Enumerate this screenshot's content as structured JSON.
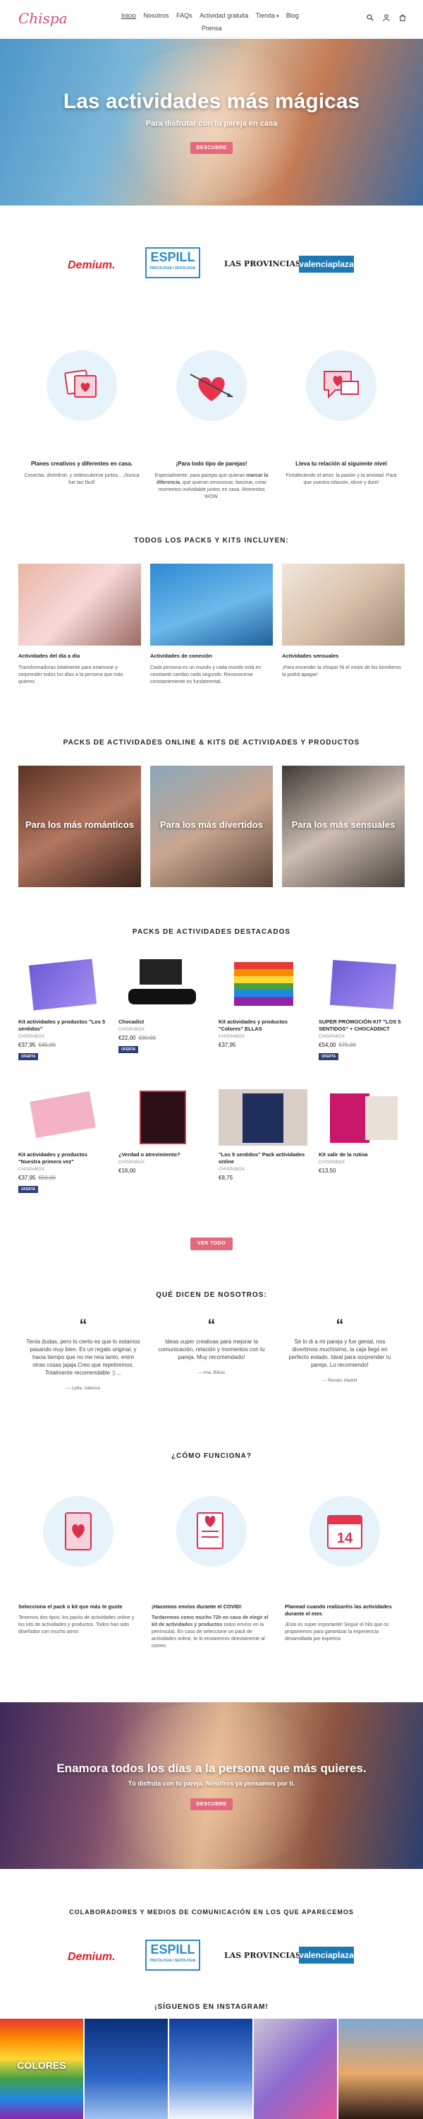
{
  "brand": {
    "logo_text": "Chispa",
    "accent": "#e26a7b",
    "navy": "#2b3f78"
  },
  "nav": {
    "items": [
      "Inicio",
      "Nosotros",
      "FAQs",
      "Actividad gratuita",
      "Tienda",
      "Blog"
    ],
    "second_line": "Prensa",
    "active": "Inicio"
  },
  "header_icons": [
    "search-icon",
    "user-icon",
    "cart-icon"
  ],
  "hero": {
    "title": "Las actividades más mágicas",
    "subtitle": "Para disfrutar con tu pareja en casa",
    "button": "DESCUBRE"
  },
  "press_logos": {
    "demium": "Demium.",
    "espill": "ESPILL",
    "espill_small": "PSICOLOGIA I SEXOLOGIA",
    "provincias": "LAS PROVINCIAS",
    "valencia": "valenciaplaza"
  },
  "features": [
    {
      "title": "Planes creativos y diferentes en casa.",
      "text": "Conectar, divertirse, y redescubrirse juntos... ¡Nunca fue tan fácil!"
    },
    {
      "title": "¡Para todo tipo de parejas!",
      "text_before": "Especialmente, para parejas que quieran ",
      "text_bold": "marcar la diferencia",
      "text_after": ", que quieran emocionar, fascinar, crear momentos inolvidable juntos en casa. Momentos WOW."
    },
    {
      "title": "Lleva tu relación al siguiente nivel",
      "text": "Fortaleciendo el amor, la pasión y la amistad. Para que vuestra relación, iduve y dure!"
    }
  ],
  "includes": {
    "title": "TODOS LOS PACKS Y KITS INCLUYEN:",
    "items": [
      {
        "title": "Actividades del día a día",
        "text": "Transformadoras totalmente para enamorar y sorprender todos los días a la persona que más quieres."
      },
      {
        "title": "Actividades de conexión",
        "text": "Cada persona es un mundo y cada mundo está en constante cambio cada segundo. Reconocerse constantemente es fundamental."
      },
      {
        "title": "Actividades sensuales",
        "text": "¡Para encender la chispa! Ni el mejor de los bomberos la podrá apagar!"
      }
    ]
  },
  "packs_online": {
    "title": "PACKS DE ACTIVIDADES ONLINE & KITS DE ACTIVIDADES Y PRODUCTOS",
    "items": [
      "Para los más románticos",
      "Para los más divertidos",
      "Para los más sensuales"
    ]
  },
  "featured": {
    "title": "PACKS DE ACTIVIDADES DESTACADOS",
    "products": [
      {
        "name": "Kit actividades y productos \"Los 5 sentidos\"",
        "vendor": "CHISPABOX",
        "price": "€37,95",
        "old_price": "€45,00",
        "sale": "OFERTA"
      },
      {
        "name": "Chocadict",
        "vendor": "CHISPABOX",
        "price": "€22,00",
        "old_price": "€30,00",
        "sale": "OFERTA"
      },
      {
        "name": "Kit actividades y productos \"Colores\" ELLAS",
        "vendor": "CHISPABOX",
        "price": "€37,95",
        "old_price": "",
        "sale": ""
      },
      {
        "name": "SUPER PROMOCIÓN KIT \"LOS 5 SENTIDOS\" + CHOCADDICT",
        "vendor": "CHISPABOX",
        "price": "€54,00",
        "old_price": "€75,00",
        "sale": "OFERTA"
      },
      {
        "name": "Kit actividades y productos \"Nuestra primera vez\"",
        "vendor": "CHISPABOX",
        "price": "€37,95",
        "old_price": "€50,00",
        "sale": "OFERTA"
      },
      {
        "name": "¿Verdad o atrevimiento?",
        "vendor": "CHISPABOX",
        "price": "€16,00",
        "old_price": "",
        "sale": ""
      },
      {
        "name": "\"Los 5 sentidos\" Pack actividades online",
        "vendor": "CHISPABOX",
        "price": "€8,75",
        "old_price": "",
        "sale": ""
      },
      {
        "name": "Kit salir de la rutina",
        "vendor": "CHISPABOX",
        "price": "€13,50",
        "old_price": "",
        "sale": ""
      }
    ],
    "button": "VER TODO"
  },
  "testimonials": {
    "title": "QUÉ DICEN DE NOSOTROS:",
    "items": [
      {
        "quote": "Tenía dudas, pero lo cierto es que lo estamos pasando muy bien. Es un regalo original, y hacia tiempo que no me reía tanto, entre otras cosas jajaja Creo que repetiremos. Totalmente recomendable :) ...",
        "author": "— Lydia, Valencia"
      },
      {
        "quote": "Ideas super creativas para mejorar la comunicación, relación y momentos con tu pareja. Muy recomendado!",
        "author": "— Ana, Bilbao"
      },
      {
        "quote": "Se lo di a mi pareja y fue genial, nos divertimos muchísimo, la caja llegó en perfecto estado. Ideal para sorprender tu pareja. Lo recomiendo!",
        "author": "— Renato, Madrid"
      }
    ]
  },
  "how": {
    "title": "¿CÓMO FUNCIONA?",
    "items": [
      {
        "title": "Selecciona el pack o kit que más te guste",
        "text": "Tenemos dos tipos: los packs de actividades online y los kits de actividades y productos. Todos han sido diseñador con mucho amor."
      },
      {
        "title": "¡Hacemos envíos durante el COVID!",
        "text_bold": "Tardaremos como mucho 72h en caso de elegir el kit de actividades y productos",
        "text_after": " todos envíos en la península). En caso de seleccione un pack de actividades online, te lo enviaremos directamente al correo."
      },
      {
        "title": "Planead cuando realizaréis las actividades durante el mes",
        "text": "¡Esto es super importante! Seguir el hilo que os proponemos para garantizar la experiencia desarrollada por expertos"
      }
    ]
  },
  "banner": {
    "title": "Enamora todos los días a la persona que más quieres.",
    "subtitle": "Tú disfruta con tu pareja. Nosotros ya pensamos por ti.",
    "button": "DESCUBRE"
  },
  "collaborators_title": "COLABORADORES Y MEDIOS DE COMUNICACIÓN EN LOS QUE APARECEMOS",
  "instagram_title": "¡SÍGUENOS EN INSTAGRAM!",
  "instagram_colores": "COLORES"
}
